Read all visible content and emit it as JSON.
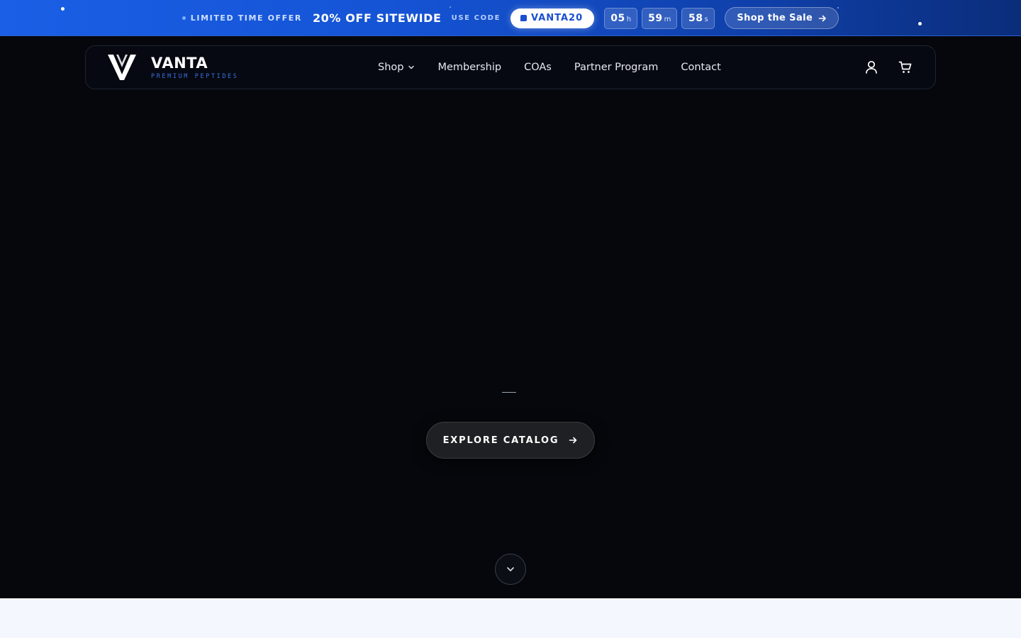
{
  "promo": {
    "limited": "LIMITED TIME OFFER",
    "headline": "20% OFF SITEWIDE",
    "use_code": "USE CODE",
    "code": "VANTA20",
    "timer": [
      {
        "value": "05",
        "unit": "h"
      },
      {
        "value": "59",
        "unit": "m"
      },
      {
        "value": "58",
        "unit": "s"
      }
    ],
    "cta": "Shop the Sale"
  },
  "nav": {
    "brand": "VANTA",
    "tagline": "PREMIUM PEPTIDES",
    "links": [
      "Shop",
      "Membership",
      "COAs",
      "Partner Program",
      "Contact"
    ],
    "icons": [
      "user-icon",
      "cart-icon"
    ]
  },
  "hero": {
    "cta": "EXPLORE CATALOG"
  },
  "colors": {
    "promo_blue": "#1a5fe6",
    "background": "#05070c",
    "code_text": "#1a4fd0",
    "tagline": "#3b6fe0"
  }
}
